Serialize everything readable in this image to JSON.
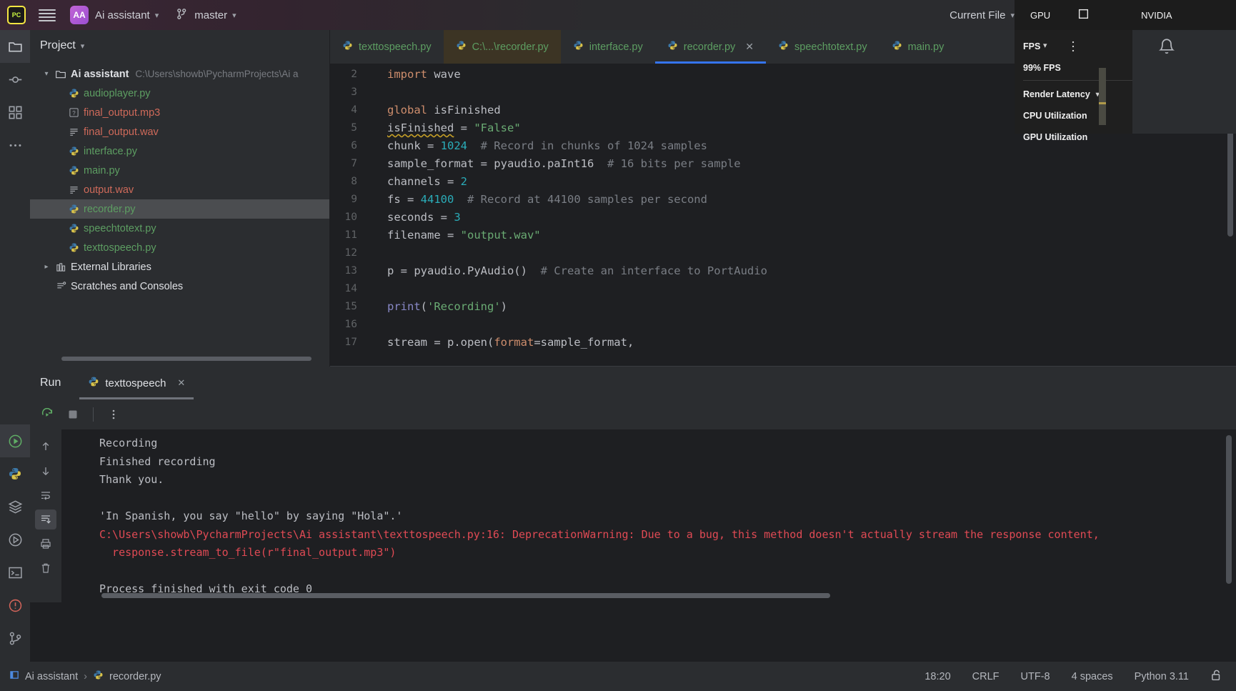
{
  "titlebar": {
    "logo_text": "PC",
    "logo_icon": "pycharm-logo-icon",
    "menu_icon": "hamburger-menu-icon",
    "project_initials": "AA",
    "project_name": "Ai assistant",
    "branch_icon": "git-branch-icon",
    "branch_name": "master",
    "run_config": "Current File",
    "run_icon": "run-play-icon",
    "debug_icon": "debug-bug-icon",
    "more_icon": "more-vertical-icon",
    "invite_icon": "add-user-icon",
    "search_icon": "search-icon",
    "settings_icon": "gear-icon"
  },
  "rail": {
    "items": [
      {
        "name": "project-tool-icon",
        "glyph": "folder"
      },
      {
        "name": "commit-tool-icon",
        "glyph": "commit"
      },
      {
        "name": "structure-tool-icon",
        "glyph": "structure"
      },
      {
        "name": "more-tool-icon",
        "glyph": "dots"
      }
    ],
    "bottom_items": [
      {
        "name": "run-tool-icon",
        "glyph": "play"
      },
      {
        "name": "python-console-icon",
        "glyph": "python"
      },
      {
        "name": "services-icon",
        "glyph": "layers"
      },
      {
        "name": "debug-tool-icon",
        "glyph": "debug"
      },
      {
        "name": "terminal-icon",
        "glyph": "terminal"
      },
      {
        "name": "problems-icon",
        "glyph": "problems"
      },
      {
        "name": "version-control-icon",
        "glyph": "vcs"
      }
    ]
  },
  "project_panel": {
    "title": "Project",
    "chevron_icon": "chevron-down-icon",
    "root": {
      "label": "Ai assistant",
      "path": "C:\\Users\\showb\\PycharmProjects\\Ai a",
      "expanded": true,
      "icon": "folder-icon"
    },
    "files": [
      {
        "label": "audioplayer.py",
        "icon": "python-file-icon",
        "color": "green",
        "selected": false
      },
      {
        "label": "final_output.mp3",
        "icon": "unknown-file-icon",
        "color": "red",
        "selected": false
      },
      {
        "label": "final_output.wav",
        "icon": "text-file-icon",
        "color": "red",
        "selected": false
      },
      {
        "label": "interface.py",
        "icon": "python-file-icon",
        "color": "green",
        "selected": false
      },
      {
        "label": "main.py",
        "icon": "python-file-icon",
        "color": "green",
        "selected": false
      },
      {
        "label": "output.wav",
        "icon": "text-file-icon",
        "color": "red",
        "selected": false
      },
      {
        "label": "recorder.py",
        "icon": "python-file-icon",
        "color": "green",
        "selected": true
      },
      {
        "label": "speechtotext.py",
        "icon": "python-file-icon",
        "color": "green",
        "selected": false
      },
      {
        "label": "texttospeech.py",
        "icon": "python-file-icon",
        "color": "green",
        "selected": false
      }
    ],
    "external_libraries": {
      "label": "External Libraries",
      "icon": "library-icon",
      "expanded": false
    },
    "scratches": {
      "label": "Scratches and Consoles",
      "icon": "scratches-icon"
    }
  },
  "editor_tabs": [
    {
      "label": "texttospeech.py",
      "icon": "python-file-icon",
      "active": false,
      "highlighted": false,
      "closable": false
    },
    {
      "label": "C:\\...\\recorder.py",
      "icon": "python-file-icon",
      "active": false,
      "highlighted": true,
      "closable": false
    },
    {
      "label": "interface.py",
      "icon": "python-file-icon",
      "active": false,
      "highlighted": false,
      "closable": false
    },
    {
      "label": "recorder.py",
      "icon": "python-file-icon",
      "active": true,
      "highlighted": false,
      "closable": true,
      "close_icon": "close-icon"
    },
    {
      "label": "speechtotext.py",
      "icon": "python-file-icon",
      "active": false,
      "highlighted": false,
      "closable": false
    },
    {
      "label": "main.py",
      "icon": "python-file-icon",
      "active": false,
      "highlighted": false,
      "closable": false
    }
  ],
  "editor": {
    "first_line_number": 2,
    "lines": [
      {
        "n": 2,
        "tokens": [
          {
            "t": "import ",
            "c": "kw"
          },
          {
            "t": "wave",
            "c": ""
          }
        ]
      },
      {
        "n": 3,
        "tokens": []
      },
      {
        "n": 4,
        "tokens": [
          {
            "t": "global ",
            "c": "kw"
          },
          {
            "t": "isFinished",
            "c": ""
          }
        ]
      },
      {
        "n": 5,
        "tokens": [
          {
            "t": "isFinished",
            "c": "warnu"
          },
          {
            "t": " = ",
            "c": ""
          },
          {
            "t": "\"False\"",
            "c": "str"
          }
        ]
      },
      {
        "n": 6,
        "tokens": [
          {
            "t": "chunk = ",
            "c": ""
          },
          {
            "t": "1024",
            "c": "num"
          },
          {
            "t": "  # Record in chunks of 1024 samples",
            "c": "cmt"
          }
        ]
      },
      {
        "n": 7,
        "tokens": [
          {
            "t": "sample_format = pyaudio.paInt16",
            "c": ""
          },
          {
            "t": "  # 16 bits per sample",
            "c": "cmt"
          }
        ]
      },
      {
        "n": 8,
        "tokens": [
          {
            "t": "channels = ",
            "c": ""
          },
          {
            "t": "2",
            "c": "num"
          }
        ]
      },
      {
        "n": 9,
        "tokens": [
          {
            "t": "fs = ",
            "c": ""
          },
          {
            "t": "44100",
            "c": "num"
          },
          {
            "t": "  # Record at 44100 samples per second",
            "c": "cmt"
          }
        ]
      },
      {
        "n": 10,
        "tokens": [
          {
            "t": "seconds = ",
            "c": ""
          },
          {
            "t": "3",
            "c": "num"
          }
        ]
      },
      {
        "n": 11,
        "tokens": [
          {
            "t": "filename = ",
            "c": ""
          },
          {
            "t": "\"output.wav\"",
            "c": "str"
          }
        ]
      },
      {
        "n": 12,
        "tokens": []
      },
      {
        "n": 13,
        "tokens": [
          {
            "t": "p = pyaudio.PyAudio()",
            "c": ""
          },
          {
            "t": "  # Create an interface to PortAudio",
            "c": "cmt"
          }
        ]
      },
      {
        "n": 14,
        "tokens": []
      },
      {
        "n": 15,
        "tokens": [
          {
            "t": "print",
            "c": "fn"
          },
          {
            "t": "(",
            "c": ""
          },
          {
            "t": "'Recording'",
            "c": "str"
          },
          {
            "t": ")",
            "c": ""
          }
        ]
      },
      {
        "n": 16,
        "tokens": []
      },
      {
        "n": 17,
        "tokens": [
          {
            "t": "stream = p.open(",
            "c": ""
          },
          {
            "t": "format",
            "c": "kw"
          },
          {
            "t": "=sample_format,",
            "c": ""
          }
        ]
      }
    ]
  },
  "run_panel": {
    "label": "Run",
    "tab": {
      "label": "texttospeech",
      "icon": "python-file-icon",
      "close_icon": "close-icon"
    },
    "toolbar": [
      {
        "name": "rerun-button",
        "glyph": "rerun"
      },
      {
        "name": "stop-button",
        "glyph": "stop"
      },
      {
        "name": "more-options-button",
        "glyph": "dots"
      }
    ],
    "side_buttons": [
      {
        "name": "scroll-up-button",
        "glyph": "arrow-up",
        "selected": false
      },
      {
        "name": "scroll-down-button",
        "glyph": "arrow-down",
        "selected": false
      },
      {
        "name": "soft-wrap-button",
        "glyph": "wrap",
        "selected": false
      },
      {
        "name": "scroll-to-end-button",
        "glyph": "scroll-end",
        "selected": true
      },
      {
        "name": "print-button",
        "glyph": "print",
        "selected": false
      },
      {
        "name": "clear-all-button",
        "glyph": "trash",
        "selected": false
      }
    ],
    "console_lines": [
      {
        "text": "Recording",
        "type": "out"
      },
      {
        "text": "Finished recording",
        "type": "out"
      },
      {
        "text": "Thank you.",
        "type": "out"
      },
      {
        "text": "",
        "type": "out"
      },
      {
        "text": "'In Spanish, you say \"hello\" by saying \"Hola\".'",
        "type": "out"
      },
      {
        "text": "C:\\Users\\showb\\PycharmProjects\\Ai assistant\\texttospeech.py:16: DeprecationWarning: Due to a bug, this method doesn't actually stream the response content,",
        "type": "err"
      },
      {
        "text": "  response.stream_to_file(r\"final_output.mp3\")",
        "type": "err"
      },
      {
        "text": "",
        "type": "out"
      },
      {
        "text": "Process finished with exit code 0",
        "type": "out"
      }
    ]
  },
  "statusbar": {
    "breadcrumb": [
      {
        "label": "Ai assistant",
        "icon": "module-icon"
      },
      {
        "label": "recorder.py",
        "icon": "python-file-icon"
      }
    ],
    "separator": "›",
    "time": "18:20",
    "line_separator": "CRLF",
    "encoding": "UTF-8",
    "indent": "4 spaces",
    "interpreter": "Python 3.11",
    "lock_icon": "unlocked-icon"
  },
  "nvidia_overlay": {
    "title": "GPU",
    "brand": "NVIDIA",
    "square_icon": "square-icon",
    "metrics": [
      {
        "label": "FPS"
      },
      {
        "label": "99% FPS"
      },
      {
        "label": "Render Latency",
        "chevron": "chevron-down-icon"
      },
      {
        "label": "CPU Utilization"
      },
      {
        "label": "GPU Utilization"
      }
    ],
    "chevron_icon": "chevron-down-icon",
    "more_icon": "more-vertical-icon",
    "bell_icon": "notification-bell-icon"
  },
  "colors": {
    "accent": "#3574f0",
    "green": "#5d9e62",
    "red": "#cf6a5a",
    "error": "#e04a54",
    "bg": "#1e1f22",
    "panel": "#2b2d30"
  }
}
